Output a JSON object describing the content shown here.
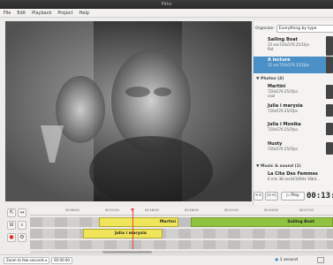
{
  "window": {
    "title": "Pitivi"
  },
  "menu": [
    "File",
    "Edit",
    "Playback",
    "Project",
    "Help"
  ],
  "sidebar": {
    "organize_label": "Organize:",
    "organize_value": "Everything by type",
    "clips_top": [
      {
        "name": "Sailing Boat",
        "meta": "15 sec720x576 25/1fps",
        "extra": "flat",
        "selected": false
      },
      {
        "name": "A lecture",
        "meta": "15 sec720x576 25/1fps",
        "selected": true
      }
    ],
    "group_photos": "Photos (4)",
    "photos": [
      {
        "name": "Martini",
        "meta": "720x576 25/1fps",
        "extra": "cool"
      },
      {
        "name": "Julia i marysia",
        "meta": "720x576 25/1fps"
      },
      {
        "name": "Julia i Monika",
        "meta": "720x576 25/1fps"
      },
      {
        "name": "Husty",
        "meta": "720x576 25/1fps"
      }
    ],
    "group_music": "Music & sound (1)",
    "music": [
      {
        "name": "La Cite Des Femmes",
        "meta": "6 min 38 sec44100Hz 16bit..."
      }
    ]
  },
  "viewer_controls": {
    "rewind": "<<",
    "step": "|<<|",
    "play": "Play",
    "timecode": "00:13:"
  },
  "timeline": {
    "ruler": [
      "00:06:00",
      "00:12:00",
      "00:18:00",
      "00:18:00",
      "00:21:00",
      "00:24:00",
      "00:27:00"
    ],
    "clip_martini": "Martini",
    "clip_sailing": "Sailing Boat",
    "clip_julia": "Julia i marysia",
    "zoom_label": "Zoom to few seconds",
    "zoom_value": "00:00:00",
    "status_right": "1 second"
  }
}
